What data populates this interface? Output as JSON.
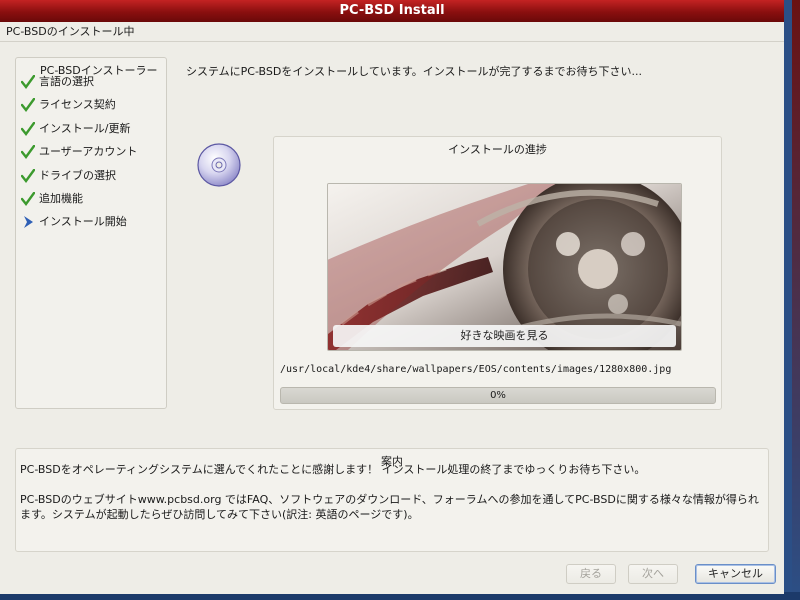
{
  "window": {
    "title": "PC-BSD Install"
  },
  "header": {
    "title": "PC-BSDのインストール中"
  },
  "steps": {
    "title": "PC-BSDインストーラー",
    "items": [
      {
        "label": "言語の選択",
        "status": "done"
      },
      {
        "label": "ライセンス契約",
        "status": "done"
      },
      {
        "label": "インストール/更新",
        "status": "done"
      },
      {
        "label": "ユーザーアカウント",
        "status": "done"
      },
      {
        "label": "ドライブの選択",
        "status": "done"
      },
      {
        "label": "追加機能",
        "status": "done"
      },
      {
        "label": "インストール開始",
        "status": "current"
      }
    ]
  },
  "status_message": "システムにPC-BSDをインストールしています。インストールが完了するまでお待ち下さい...",
  "progress_panel": {
    "title": "インストールの進捗",
    "slide_caption": "好きな映画を見る",
    "current_file": "/usr/local/kde4/share/wallpapers/EOS/contents/images/1280x800.jpg",
    "progress_text": "0%",
    "progress_value": 0
  },
  "info_panel": {
    "title": "案内",
    "text": "PC-BSDをオペレーティングシステムに選んでくれたことに感謝します！ インストール処理の終了までゆっくりお待ち下さい。\n\nPC-BSDのウェブサイトwww.pcbsd.org ではFAQ、ソフトウェアのダウンロード、フォーラムへの参加を通してPC-BSDに関する様々な情報が得られます。システムが起動したらぜひ訪問してみて下さい(訳注: 英語のページです)。"
  },
  "buttons": {
    "back": "戻る",
    "next": "次へ",
    "cancel": "キャンセル"
  },
  "colors": {
    "titlebar": "#a01818",
    "check": "#3c9a2e",
    "current_arrow": "#2f5fb5",
    "progress_fill": "#4a79c0"
  }
}
